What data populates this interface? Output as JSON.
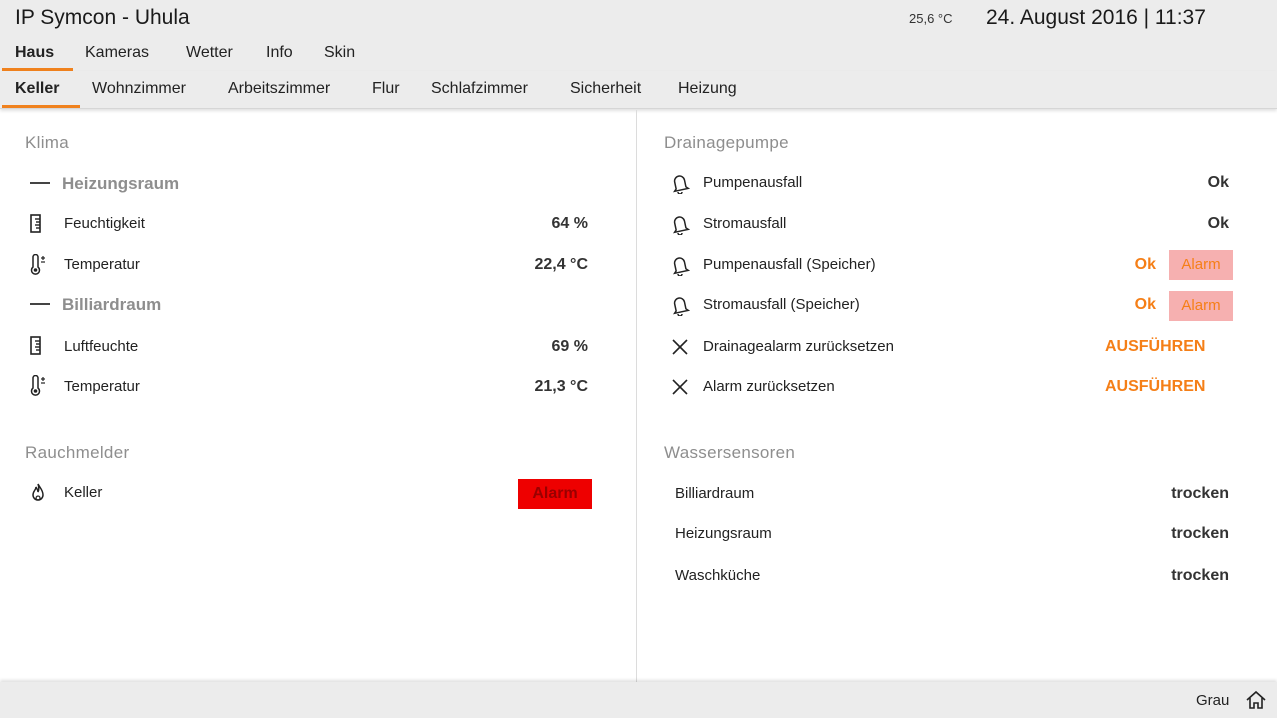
{
  "header": {
    "title": "IP Symcon - Uhula",
    "outdoor_temp": "25,6 °C",
    "datetime": "24. August 2016 | 11:37"
  },
  "nav_main": {
    "items": [
      {
        "label": "Haus",
        "active": true
      },
      {
        "label": "Kameras"
      },
      {
        "label": "Wetter"
      },
      {
        "label": "Info"
      },
      {
        "label": "Skin"
      }
    ]
  },
  "nav_sub": {
    "items": [
      {
        "label": "Keller",
        "active": true
      },
      {
        "label": "Wohnzimmer"
      },
      {
        "label": "Arbeitszimmer"
      },
      {
        "label": "Flur"
      },
      {
        "label": "Schlafzimmer"
      },
      {
        "label": "Sicherheit"
      },
      {
        "label": "Heizung"
      }
    ]
  },
  "left": {
    "klima": {
      "title": "Klima",
      "groups": [
        {
          "name": "Heizungsraum",
          "rows": [
            {
              "icon": "humidity-gauge-icon",
              "label": "Feuchtigkeit",
              "value": "64 %"
            },
            {
              "icon": "thermometer-icon",
              "label": "Temperatur",
              "value": "22,4 °C"
            }
          ]
        },
        {
          "name": "Billiardraum",
          "rows": [
            {
              "icon": "humidity-gauge-icon",
              "label": "Luftfeuchte",
              "value": "69 %"
            },
            {
              "icon": "thermometer-icon",
              "label": "Temperatur",
              "value": "21,3 °C"
            }
          ]
        }
      ]
    },
    "rauchmelder": {
      "title": "Rauchmelder",
      "rows": [
        {
          "icon": "flame-icon",
          "label": "Keller",
          "value": "Alarm"
        }
      ]
    }
  },
  "right": {
    "drainagepumpe": {
      "title": "Drainagepumpe",
      "rows": [
        {
          "icon": "bell-icon",
          "label": "Pumpenausfall",
          "value": "Ok"
        },
        {
          "icon": "bell-icon",
          "label": "Stromausfall",
          "value": "Ok"
        },
        {
          "icon": "bell-icon",
          "label": "Pumpenausfall (Speicher)",
          "value": "Ok",
          "button": "Alarm"
        },
        {
          "icon": "bell-icon",
          "label": "Stromausfall (Speicher)",
          "value": "Ok",
          "button": "Alarm"
        },
        {
          "icon": "close-icon",
          "label": "Drainagealarm zurücksetzen",
          "action": "AUSFÜHREN"
        },
        {
          "icon": "close-icon",
          "label": "Alarm zurücksetzen",
          "action": "AUSFÜHREN"
        }
      ]
    },
    "wassersensoren": {
      "title": "Wassersensoren",
      "rows": [
        {
          "label": "Billiardraum",
          "value": "trocken"
        },
        {
          "label": "Heizungsraum",
          "value": "trocken"
        },
        {
          "label": "Waschküche",
          "value": "trocken"
        }
      ]
    }
  },
  "footer": {
    "skin": "Grau",
    "home_icon": "home-icon"
  },
  "colors": {
    "accent": "#f57f17",
    "bar_bg": "#ececec",
    "alarm_red": "#ee0000",
    "alarm_pink": "#f6b0b0"
  }
}
